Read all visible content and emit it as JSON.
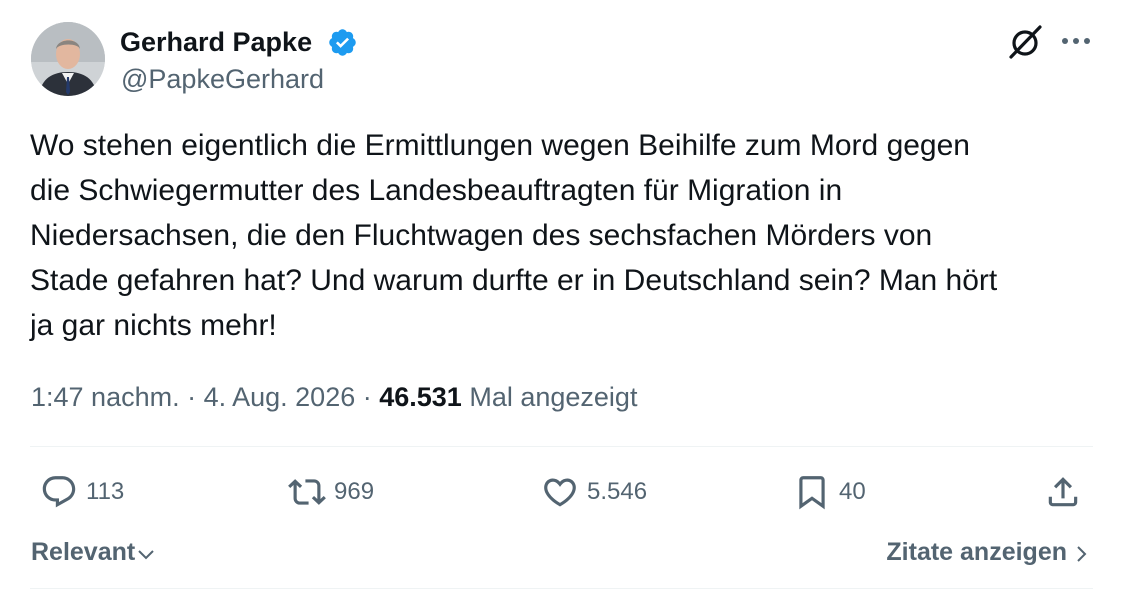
{
  "author": {
    "name": "Gerhard Papke",
    "handle": "@PapkeGerhard",
    "verified": true,
    "avatar_icon": "person-photo"
  },
  "tweet": {
    "text": "Wo stehen eigentlich die Ermittlungen wegen Beihilfe zum Mord gegen\ndie Schwiegermutter des Landesbeauftragten für Migration in\nNiedersachsen, die den Fluchtwagen des sechsfachen Mörders von\nStade gefahren hat? Und warum durfte er in Deutschland sein? Man hört\nja gar nichts mehr!"
  },
  "meta": {
    "time": "1:47 nachm.",
    "separator": " · ",
    "date": "4. Aug. 2026",
    "views_count": "46.531",
    "views_label": "Mal angezeigt"
  },
  "actions": {
    "replies": "113",
    "reposts": "969",
    "likes": "5.546",
    "bookmarks": "40"
  },
  "footer": {
    "sort_label": "Relevant",
    "quotes_label": "Zitate anzeigen"
  },
  "colors": {
    "text": "#0f1419",
    "secondary": "#536471",
    "verified_badge": "#1d9bf0",
    "divider": "#eff3f4"
  },
  "icons": [
    "grok-icon",
    "more-icon",
    "verified-badge-icon",
    "reply-icon",
    "repost-icon",
    "like-icon",
    "bookmark-icon",
    "share-icon",
    "chevron-down-icon",
    "chevron-right-icon"
  ]
}
